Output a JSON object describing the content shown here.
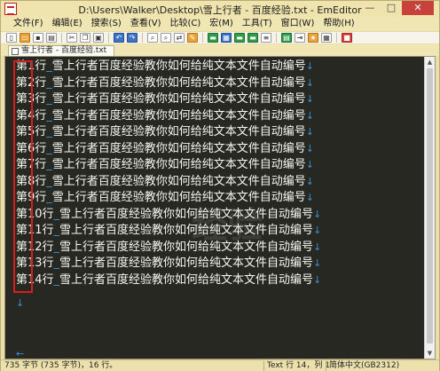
{
  "window": {
    "title": "D:\\Users\\Walker\\Desktop\\雪上行者 - 百度经验.txt - EmEditor",
    "controls": [
      "—",
      "□",
      "✕"
    ]
  },
  "menu": [
    "文件(F)",
    "编辑(E)",
    "搜索(S)",
    "查看(V)",
    "比较(C)",
    "宏(M)",
    "工具(T)",
    "窗口(W)",
    "帮助(H)"
  ],
  "toolbar": {
    "icons": [
      "new-file-icon",
      "open-folder-icon",
      "save-icon",
      "print-icon",
      "cut-icon",
      "copy-icon",
      "paste-icon",
      "undo-icon",
      "redo-icon",
      "find-icon",
      "find-next-icon",
      "replace-icon",
      "bookmark-icon",
      "toggle-view-icon",
      "layout-icon",
      "split-icon",
      "marker-icon",
      "list-icon",
      "outline-icon",
      "word-wrap-icon",
      "macro-icon",
      "config-icon",
      "stop-icon"
    ]
  },
  "tab": {
    "label": "雪上行者 - 百度经验.txt"
  },
  "editor": {
    "line_text": "雪上行者百度经验教你如何给纯文本文件自动编号",
    "prefix_suffix": "行",
    "separator": "_",
    "eol_mark": "↓",
    "eof_mark": "←",
    "lines": [
      {
        "num": "第1行"
      },
      {
        "num": "第2行"
      },
      {
        "num": "第3行"
      },
      {
        "num": "第4行"
      },
      {
        "num": "第5行"
      },
      {
        "num": "第6行"
      },
      {
        "num": "第7行"
      },
      {
        "num": "第8行"
      },
      {
        "num": "第9行"
      },
      {
        "num": "第10行"
      },
      {
        "num": "第11行"
      },
      {
        "num": "第12行"
      },
      {
        "num": "第13行"
      },
      {
        "num": "第14行"
      }
    ],
    "watermark": "经验"
  },
  "status": {
    "left": "735 字节 (735 字节)，16 行。",
    "mid": "Text  行 14，列 1",
    "right": "简体中文(GB2312)"
  },
  "colors": {
    "editor_bg": "#272822",
    "text": "#f8f8f2",
    "marker": "#3b8fd8",
    "highlight": "#d71e1e"
  }
}
